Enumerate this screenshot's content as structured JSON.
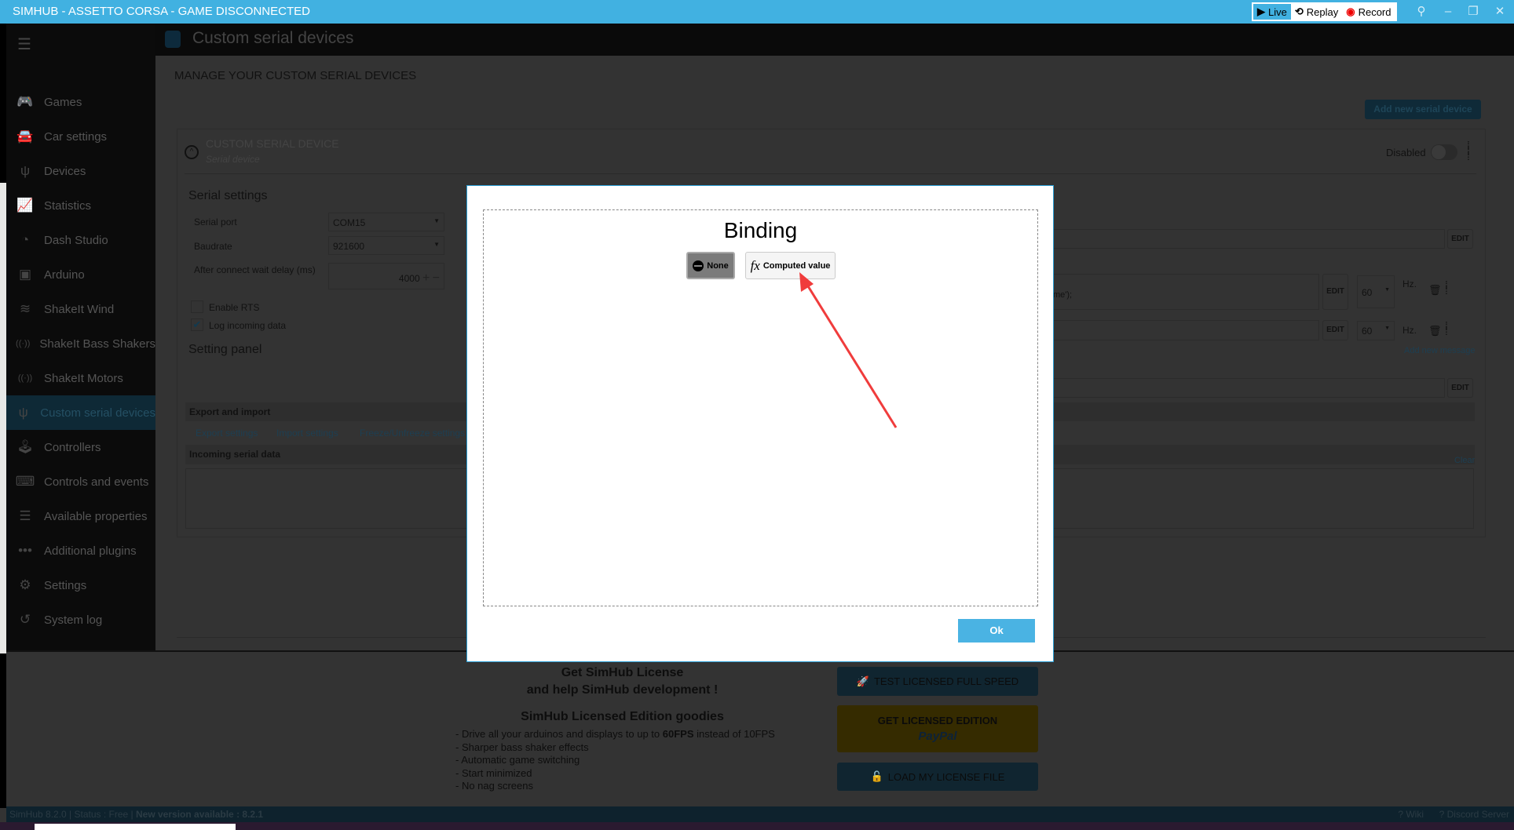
{
  "titlebar": {
    "title": "SIMHUB - ASSETTO CORSA - GAME DISCONNECTED",
    "live": "Live",
    "replay": "Replay",
    "record": "Record"
  },
  "header": {
    "title": "Custom serial devices"
  },
  "sidebar": {
    "items": [
      {
        "label": "Games",
        "icon": "gamepad-icon"
      },
      {
        "label": "Car settings",
        "icon": "car-icon"
      },
      {
        "label": "Devices",
        "icon": "usb-icon"
      },
      {
        "label": "Statistics",
        "icon": "chart-icon"
      },
      {
        "label": "Dash Studio",
        "icon": "gauge-icon"
      },
      {
        "label": "Arduino",
        "icon": "arduino-icon"
      },
      {
        "label": "ShakeIt Wind",
        "icon": "wind-icon"
      },
      {
        "label": "ShakeIt Bass Shakers",
        "icon": "vibration-icon"
      },
      {
        "label": "ShakeIt Motors",
        "icon": "vibration-icon"
      },
      {
        "label": "Custom serial devices",
        "icon": "usb-icon"
      },
      {
        "label": "Controllers",
        "icon": "controller-icon"
      },
      {
        "label": "Controls and events",
        "icon": "keyboard-icon"
      },
      {
        "label": "Available properties",
        "icon": "list-icon"
      },
      {
        "label": "Additional plugins",
        "icon": "dots-icon"
      },
      {
        "label": "Settings",
        "icon": "gear-icon"
      },
      {
        "label": "System log",
        "icon": "history-icon"
      }
    ],
    "selected": 9
  },
  "main": {
    "title": "MANAGE YOUR CUSTOM SERIAL DEVICES",
    "add_button": "Add new serial device",
    "device": {
      "title": "CUSTOM SERIAL DEVICE",
      "subtitle": "Serial device",
      "toggle_label": "Disabled",
      "enabled": false
    },
    "serial_settings": {
      "heading": "Serial settings",
      "port_label": "Serial port",
      "port_value": "COM15",
      "baud_label": "Baudrate",
      "baud_value": "921600",
      "delay_label": "After connect wait delay (ms)",
      "delay_value": "4000",
      "rts_label": "Enable RTS",
      "rts_checked": false,
      "log_label": "Log incoming data",
      "log_checked": true
    },
    "setting_panel": "Setting panel",
    "messages": {
      "row1_text": "me');",
      "rate1": "60",
      "rate2": "60",
      "hz": "Hz.",
      "edit": "EDIT",
      "add_message": "Add new message"
    },
    "export": {
      "heading": "Export and import",
      "export": "Export settings",
      "import": "Import settings",
      "freeze": "Freeze/Unfreeze settings"
    },
    "incoming": {
      "heading": "Incoming serial data",
      "clear": "Clear"
    }
  },
  "dialog": {
    "title": "Binding",
    "none": "None",
    "computed": "Computed value",
    "ok": "Ok"
  },
  "license": {
    "line1": "Get SimHub License",
    "line2": "and help SimHub development !",
    "goodies_title": "SimHub Licensed Edition goodies",
    "goodies": [
      "- Drive all your arduinos and displays to up to ",
      "60FPS",
      " instead of 10FPS",
      "- Sharper bass shaker effects",
      "- Automatic game switching",
      "- Start minimized",
      "- No nag screens"
    ],
    "test": "TEST LICENSED FULL SPEED",
    "get": "GET LICENSED EDITION",
    "paypal": "PayPal",
    "load": "LOAD MY LICENSE FILE"
  },
  "status": {
    "version": "SimHub 8.2.0",
    "status": "Status : Free",
    "update": "New version available : 8.2.1",
    "wiki": "? Wiki",
    "discord": "? Discord Server"
  },
  "colors": {
    "accent": "#41b1e1",
    "ok_button": "#4ab3e3",
    "arrow": "#f03c3c"
  }
}
